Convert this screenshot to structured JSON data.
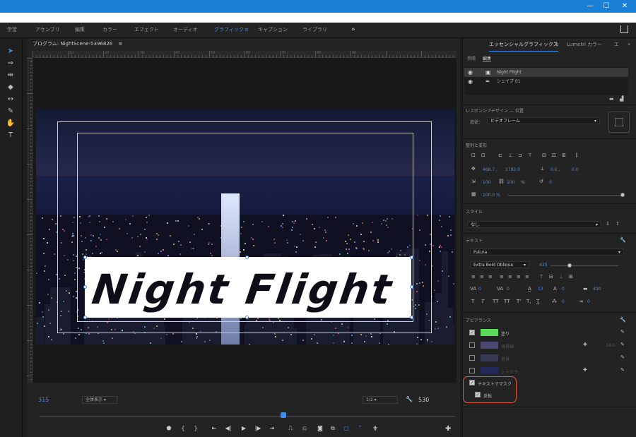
{
  "window": {
    "minimize": "—",
    "maximize": "☐",
    "close": "✕"
  },
  "workspaces": {
    "items": [
      "学習",
      "アセンブリ",
      "編集",
      "カラー",
      "エフェクト",
      "オーディオ",
      "グラフィック",
      "キャプション",
      "ライブラリ"
    ],
    "active_index": 6,
    "active_menu": "≡",
    "more": "»"
  },
  "tools": [
    "select-tool",
    "track-select-tool",
    "ripple-edit-tool",
    "razor-tool",
    "slip-tool",
    "pen-tool",
    "hand-tool",
    "type-tool"
  ],
  "program_monitor": {
    "title": "プログラム: NightScene-5396826",
    "menu": "≡",
    "title_text": "Night Flight",
    "timecode_left": "315",
    "zoom": "全体表示",
    "resolution": "1/2",
    "timecode_right": "530",
    "ruler_numbers": [
      "10",
      "20",
      "30",
      "40",
      "50",
      "60",
      "70",
      "80",
      "90"
    ]
  },
  "panel": {
    "tabs": [
      "エッセンシャルグラフィックス",
      "≡",
      "Lumetri カラー",
      "エ",
      "»"
    ],
    "subtabs": [
      "参照",
      "編集"
    ],
    "layers": [
      {
        "name": "Night Flight",
        "icon": "text-layer-icon",
        "selected": true
      },
      {
        "name": "シェイプ 01",
        "icon": "pen-shape-icon",
        "selected": false
      }
    ],
    "responsive": {
      "title": "レスポンシブデザイン ― 位置",
      "follow_label": "追従：",
      "follow_value": "ビデオフレーム"
    },
    "align": {
      "title": "整列と変形",
      "pos_x": "468.7 ,",
      "pos_y": "1792.0",
      "anchor_x": "0.0 ,",
      "anchor_y": "0.0",
      "scale": "100",
      "scale_unit": "%",
      "rotation": "0",
      "opacity": "100.0 %"
    },
    "style": {
      "title": "スタイル",
      "value": "なし"
    },
    "text": {
      "title": "テキスト",
      "font": "Futura",
      "style": "Extra Bold Oblique",
      "size": "425",
      "tracking": "0",
      "kerning": "0",
      "leading": "13",
      "baseline": "0",
      "tsume": "400",
      "tsume2": "0",
      "tabwidth": "0",
      "format_buttons": [
        "T",
        "T",
        "TT",
        "TT",
        "T'",
        "T,",
        "T"
      ]
    },
    "appearance": {
      "title": "アピアランス",
      "fill_label": "塗り",
      "fill_color": "#5ad85a",
      "stroke_label": "境界線",
      "stroke_value": "14.0",
      "background_label": "背景",
      "shadow_label": "シャドウ",
      "mask_label": "テキストでマスク",
      "invert_label": "反転",
      "mask_checked": true,
      "invert_checked": true
    }
  }
}
